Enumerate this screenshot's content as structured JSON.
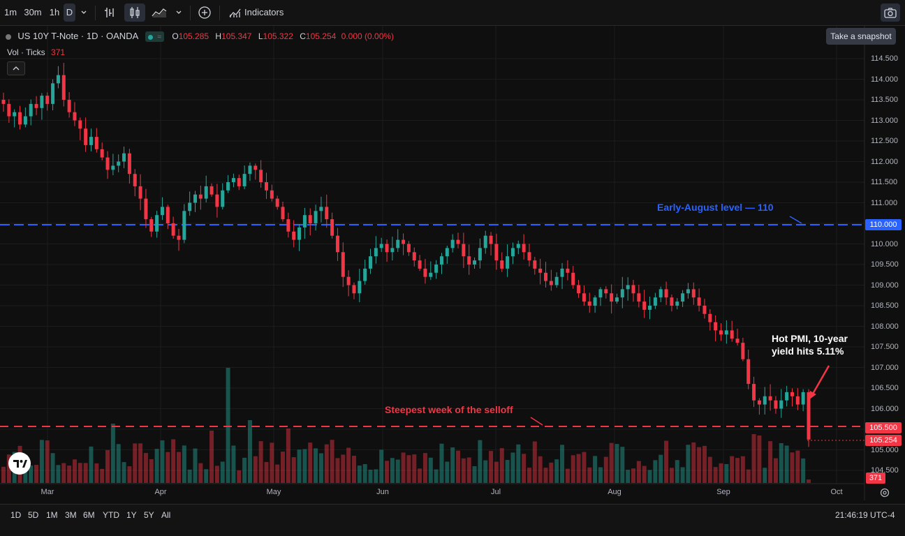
{
  "toolbar": {
    "intervals": [
      "1m",
      "30m",
      "1h",
      "D"
    ],
    "indicators_label": "Indicators",
    "snapshot_tooltip": "Take a snapshot"
  },
  "legend": {
    "symbol": "US 10Y T-Note · 1D · OANDA",
    "o_label": "O",
    "o": "105.285",
    "h_label": "H",
    "h": "105.347",
    "l_label": "L",
    "l": "105.322",
    "c_label": "C",
    "c": "105.254",
    "change": "0.000 (0.00%)",
    "vol_label": "Vol · Ticks",
    "vol_value": "371"
  },
  "price_scale": {
    "ticks": [
      "114.500",
      "114.000",
      "113.500",
      "113.000",
      "112.500",
      "112.000",
      "111.500",
      "111.000",
      "110.500",
      "110.000",
      "109.500",
      "109.000",
      "108.500",
      "108.000",
      "107.500",
      "107.000",
      "106.500",
      "106.000",
      "105.500",
      "105.000",
      "104.500"
    ],
    "tag_110": "110.000",
    "tag_1055": "105.500",
    "tag_last": "105.254",
    "tag_volume": "371"
  },
  "time_axis": {
    "months": [
      "Mar",
      "Apr",
      "May",
      "Jun",
      "Jul",
      "Aug",
      "Sep",
      "Oct"
    ]
  },
  "annotations": {
    "early_august": "Early-August level — 110",
    "steepest_week": "Steepest week of the selloff",
    "hot_pmi_line1": "Hot PMI, 10-year",
    "hot_pmi_line2": "yield hits 5.11%"
  },
  "bottom_bar": {
    "ranges": [
      "1D",
      "5D",
      "1M",
      "3M",
      "6M",
      "YTD",
      "1Y",
      "5Y",
      "All"
    ],
    "clock": "21:46:19 UTC-4"
  },
  "colors": {
    "up": "#26a69a",
    "down": "#f23645",
    "blue_line": "#2962ff",
    "red_line": "#f23645"
  },
  "chart_data": {
    "type": "candlestick",
    "symbol": "US 10Y T-Note",
    "interval": "1D",
    "ylim": [
      104.5,
      114.5
    ],
    "x_labels": [
      "Mar",
      "Apr",
      "May",
      "Jun",
      "Jul",
      "Aug",
      "Sep",
      "Oct"
    ],
    "horizontal_lines": [
      {
        "value": 110.0,
        "style": "dashed",
        "color": "blue",
        "label": "Early-August level — 110"
      },
      {
        "value": 105.5,
        "style": "dashed",
        "color": "red",
        "label": "Steepest week of the selloff"
      }
    ],
    "closes": [
      113.4,
      113.1,
      113.2,
      112.9,
      113.1,
      113.4,
      113.3,
      113.6,
      113.4,
      113.9,
      114.1,
      113.5,
      113.2,
      113.0,
      112.8,
      112.4,
      112.6,
      112.3,
      112.1,
      111.8,
      111.9,
      112.0,
      112.2,
      111.7,
      111.4,
      111.1,
      110.6,
      110.3,
      110.7,
      110.9,
      110.5,
      110.2,
      110.1,
      110.8,
      111.0,
      111.2,
      111.1,
      111.4,
      111.2,
      110.9,
      111.3,
      111.5,
      111.6,
      111.4,
      111.7,
      111.9,
      111.8,
      111.5,
      111.3,
      111.1,
      110.9,
      110.6,
      110.3,
      110.1,
      110.4,
      110.7,
      110.5,
      110.8,
      110.9,
      110.6,
      110.2,
      109.8,
      109.2,
      109.0,
      108.8,
      109.1,
      109.4,
      109.7,
      109.9,
      110.0,
      109.8,
      109.9,
      110.1,
      110.0,
      109.8,
      109.6,
      109.4,
      109.2,
      109.3,
      109.5,
      109.7,
      109.9,
      110.1,
      110.0,
      109.7,
      109.5,
      109.6,
      109.9,
      110.2,
      110.0,
      109.6,
      109.4,
      109.7,
      109.9,
      110.0,
      109.8,
      109.6,
      109.4,
      109.3,
      109.1,
      109.0,
      109.2,
      109.4,
      109.3,
      109.0,
      108.8,
      108.6,
      108.5,
      108.7,
      108.9,
      108.8,
      108.6,
      108.7,
      108.9,
      109.0,
      108.8,
      108.6,
      108.4,
      108.5,
      108.7,
      108.9,
      108.7,
      108.5,
      108.6,
      108.8,
      108.9,
      108.7,
      108.5,
      108.3,
      108.1,
      107.9,
      107.8,
      107.9,
      107.7,
      107.6,
      107.2,
      106.6,
      106.2,
      106.1,
      106.3,
      106.2,
      106.0,
      106.2,
      106.4,
      106.3,
      106.1,
      106.4,
      105.25
    ],
    "volume_last": 371
  }
}
